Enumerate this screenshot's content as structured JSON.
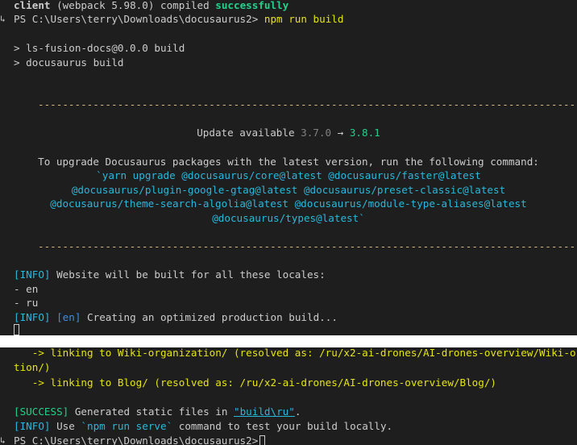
{
  "top": {
    "compiled": {
      "client": "client",
      "webpack": "(webpack 5.98.0) compiled",
      "status": "successfully"
    },
    "prompt1": {
      "path": "PS C:\\Users\\terry\\Downloads\\docusaurus2>",
      "command": "npm run build"
    },
    "script_lines": [
      "> ls-fusion-docs@0.0.0 build",
      "> docusaurus build"
    ],
    "dash_line": "------------------------------------------------------------------------------------------------",
    "update": {
      "label": "Update available",
      "from": "3.7.0",
      "arrow": "→",
      "to": "3.8.1"
    },
    "upgrade_text": "To upgrade Docusaurus packages with the latest version, run the following command:",
    "upgrade_cmd": [
      "`yarn upgrade @docusaurus/core@latest @docusaurus/faster@latest",
      "@docusaurus/plugin-google-gtag@latest @docusaurus/preset-classic@latest",
      "@docusaurus/theme-search-algolia@latest @docusaurus/module-type-aliases@latest",
      "@docusaurus/types@latest`"
    ],
    "info1": {
      "tag": "[INFO]",
      "text": "Website will be built for all these locales:"
    },
    "locales": [
      "- en",
      "- ru"
    ],
    "info2": {
      "tag": "[INFO]",
      "locale": "[en]",
      "text": "Creating an optimized production build..."
    }
  },
  "bottom": {
    "link_lines": [
      "   -> linking to Wiki-organization/ (resolved as: /ru/x2-ai-drones/AI-drones-overview/Wiki-o",
      "tion/)",
      "   -> linking to Blog/ (resolved as: /ru/x2-ai-drones/AI-drones-overview/Blog/)"
    ],
    "success": {
      "tag": "[SUCCESS]",
      "text": "Generated static files in",
      "path": "\"build\\ru\"",
      "end": "."
    },
    "info3": {
      "tag": "[INFO]",
      "pre": "Use",
      "cmd": "`npm run serve`",
      "post": "command to test your build locally."
    },
    "prompt2": {
      "path": "PS C:\\Users\\terry\\Downloads\\docusaurus2>"
    }
  },
  "colors": {
    "background": "#1e1e1e",
    "green": "#23d18b",
    "yellow": "#e5e510",
    "cyan": "#29b8db",
    "blue": "#3b8eea",
    "divider": "#ffffff"
  }
}
